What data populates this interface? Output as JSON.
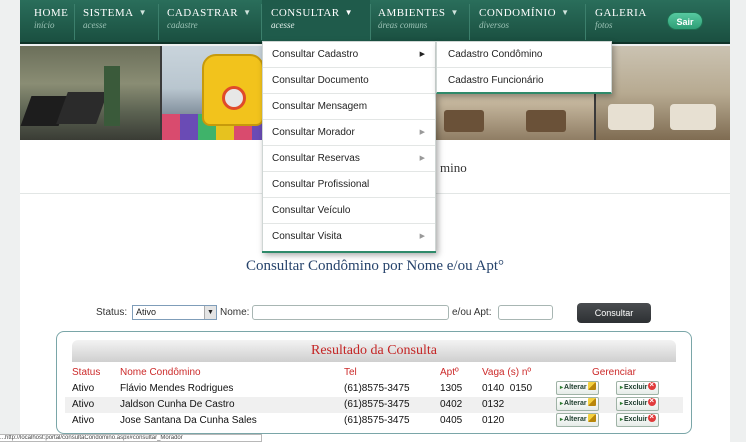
{
  "nav": {
    "items": [
      {
        "title": "HOME",
        "sub": "início",
        "has_arrow": false
      },
      {
        "title": "SISTEMA",
        "sub": "acesse",
        "has_arrow": true
      },
      {
        "title": "CADASTRAR",
        "sub": "cadastre",
        "has_arrow": true
      },
      {
        "title": "CONSULTAR",
        "sub": "acesse",
        "has_arrow": true
      },
      {
        "title": "AMBIENTES",
        "sub": "áreas comuns",
        "has_arrow": true
      },
      {
        "title": "CONDOMÍNIO",
        "sub": "diversos",
        "has_arrow": true
      },
      {
        "title": "GALERIA",
        "sub": "fotos",
        "has_arrow": false
      }
    ],
    "arrow_glyph": "▼",
    "logout_label": "Sair",
    "accent_color": "#1f5b4b"
  },
  "consultar_menu": {
    "items": [
      {
        "label": "Consultar Cadastro",
        "has_submenu": true
      },
      {
        "label": "Consultar Documento",
        "has_submenu": false
      },
      {
        "label": "Consultar Mensagem",
        "has_submenu": false
      },
      {
        "label": "Consultar Morador",
        "has_submenu": true
      },
      {
        "label": "Consultar Reservas",
        "has_submenu": true
      },
      {
        "label": "Consultar Profissional",
        "has_submenu": false
      },
      {
        "label": "Consultar Veículo",
        "has_submenu": false
      },
      {
        "label": "Consultar Visita",
        "has_submenu": true
      }
    ],
    "submenu_glyph": "▶",
    "submenu": [
      "Cadastro Condômino",
      "Cadastro Funcionário"
    ]
  },
  "band_text": "mino",
  "page_title": "Consultar Condômino por Nome e/ou Apt°",
  "filters": {
    "status_label": "Status:",
    "status_value": "Ativo",
    "status_dropdown_glyph": "▼",
    "name_label": "Nome:",
    "name_value": "",
    "apt_label": "e/ou Apt:",
    "apt_value": "",
    "submit_label": "Consultar"
  },
  "results": {
    "title": "Resultado da Consulta",
    "headers": [
      "Status",
      "Nome Condômino",
      "Tel",
      "Aptº",
      "Vaga (s) nº",
      "Gerenciar"
    ],
    "rows": [
      {
        "status": "Ativo",
        "nome": "Flávio Mendes Rodrigues",
        "tel": "(61)8575-3475",
        "apt": "1305",
        "vagas": "0140  0150"
      },
      {
        "status": "Ativo",
        "nome": "Jaldson Cunha De Castro",
        "tel": "(61)8575-3475",
        "apt": "0402",
        "vagas": "0132"
      },
      {
        "status": "Ativo",
        "nome": "Jose Santana Da Cunha Sales",
        "tel": "(61)8575-3475",
        "apt": "0405",
        "vagas": "0120"
      }
    ],
    "edit_label": "Alterar",
    "delete_label": "Excluir",
    "action_glyph": "▸"
  },
  "statusbar_text": "...http://localhost:portal/consultaCondomino.aspx#consultar_Morador",
  "colors": {
    "nav_bg": "#1a4f40",
    "title": "#26436b",
    "results_title": "#c42525",
    "headers": "#cc2a2a"
  }
}
